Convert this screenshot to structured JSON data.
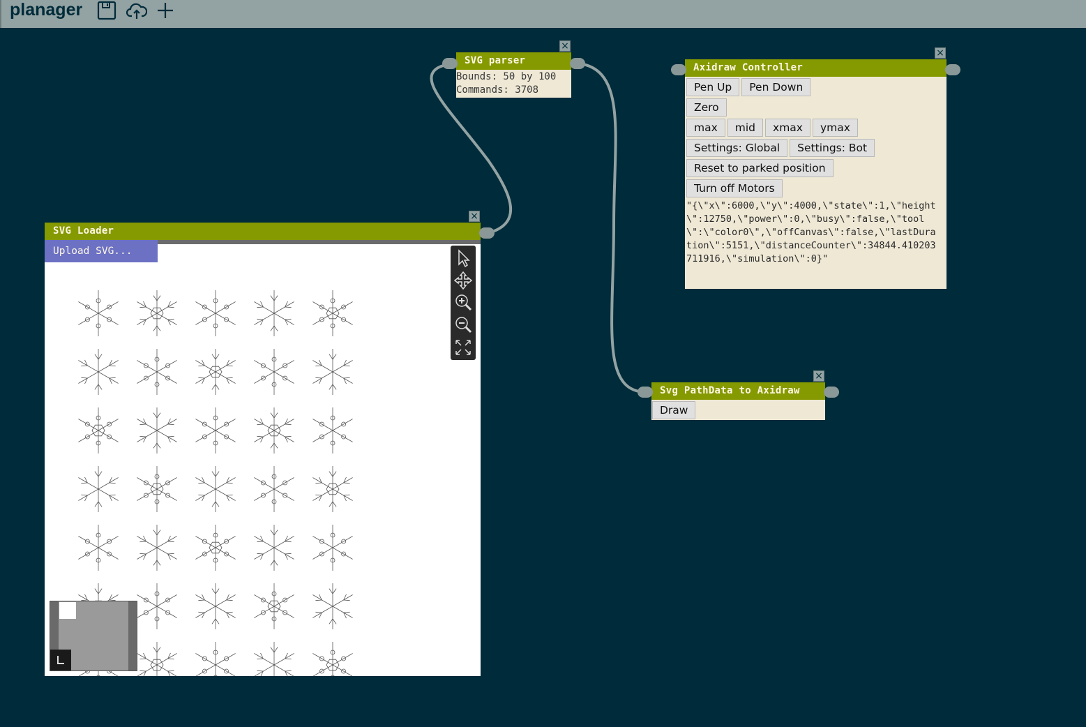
{
  "app": {
    "title": "planager"
  },
  "toolbar": {
    "icons": [
      "save-icon",
      "cloud-upload-icon",
      "plus-icon"
    ]
  },
  "colors": {
    "background": "#002b3a",
    "topbar": "#93a2a2",
    "node_header": "#859900",
    "node_body": "#eee8d5",
    "upload": "#6c71c4",
    "wire": "#93a2a2"
  },
  "svg_parser": {
    "title": "SVG parser",
    "bounds": "Bounds: 50 by 100",
    "commands": "Commands: 3708",
    "close": "×"
  },
  "svg_loader": {
    "title": "SVG Loader",
    "upload_label": "Upload SVG...",
    "close": "×",
    "tools": [
      "select-tool-icon",
      "pan-tool-icon",
      "zoom-in-icon",
      "zoom-out-icon",
      "fit-view-icon"
    ]
  },
  "axidraw": {
    "title": "Axidraw Controller",
    "close": "×",
    "buttons": {
      "pen_up": "Pen Up",
      "pen_down": "Pen Down",
      "zero": "Zero",
      "max": "max",
      "mid": "mid",
      "xmax": "xmax",
      "ymax": "ymax",
      "settings_global": "Settings: Global",
      "settings_bot": "Settings: Bot",
      "reset_parked": "Reset to parked position",
      "turn_off_motors": "Turn off Motors"
    },
    "state_json": "\"{\\\"x\\\":6000,\\\"y\\\":4000,\\\"state\\\":1,\\\"height\\\":12750,\\\"power\\\":0,\\\"busy\\\":false,\\\"tool\\\":\\\"color0\\\",\\\"offCanvas\\\":false,\\\"lastDuration\\\":5151,\\\"distanceCounter\\\":34844.410203711916,\\\"simulation\\\":0}\""
  },
  "pathdata": {
    "title": "Svg PathData to Axidraw",
    "draw_label": "Draw",
    "close": "×"
  }
}
